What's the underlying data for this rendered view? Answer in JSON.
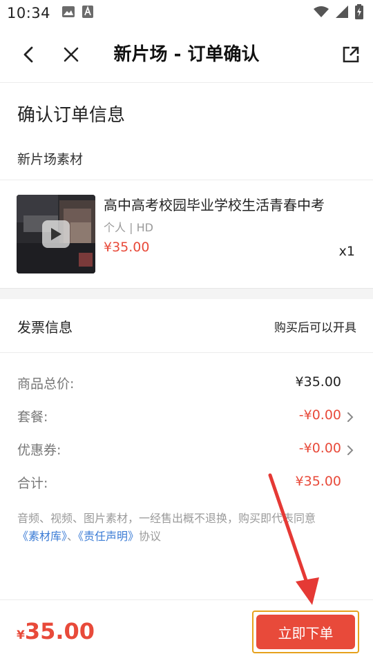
{
  "status_bar": {
    "time": "10:34",
    "left_icons": [
      "image-icon",
      "a-badge-icon"
    ],
    "right_icons": [
      "wifi-icon",
      "signal-icon",
      "battery-charging-icon"
    ]
  },
  "nav": {
    "title": "新片场 - 订单确认",
    "back_icon": "chevron-left-icon",
    "close_icon": "close-icon",
    "share_icon": "share-external-icon"
  },
  "order": {
    "section_title": "确认订单信息",
    "source": "新片场素材"
  },
  "product": {
    "name": "高中高考校园毕业学校生活青春中考",
    "meta": "个人 | HD",
    "price": "¥35.00",
    "quantity": "x1",
    "thumbnail_icon": "play-icon"
  },
  "invoice": {
    "label": "发票信息",
    "value": "购买后可以开具"
  },
  "fees": [
    {
      "label": "商品总价:",
      "value": "¥35.00",
      "highlight": false,
      "has_chevron": false
    },
    {
      "label": "套餐:",
      "value": "-¥0.00",
      "highlight": true,
      "has_chevron": true
    },
    {
      "label": "优惠券:",
      "value": "-¥0.00",
      "highlight": true,
      "has_chevron": true
    },
    {
      "label": "合计:",
      "value": "¥35.00",
      "highlight": true,
      "has_chevron": false
    }
  ],
  "agreement": {
    "text": "音频、视频、图片素材，一经售出概不退换，购买即代表同意",
    "link_1": "《素材库》",
    "separator": "、",
    "link_2": "《责任声明》",
    "suffix": "协议"
  },
  "bottom": {
    "currency": "¥",
    "amount": "35.00",
    "order_button": "立即下单"
  },
  "colors": {
    "accent_red": "#e84a3a",
    "link_blue": "#3a7bd5",
    "highlight_border": "#e6a11c",
    "annotation_arrow": "#e53935"
  }
}
